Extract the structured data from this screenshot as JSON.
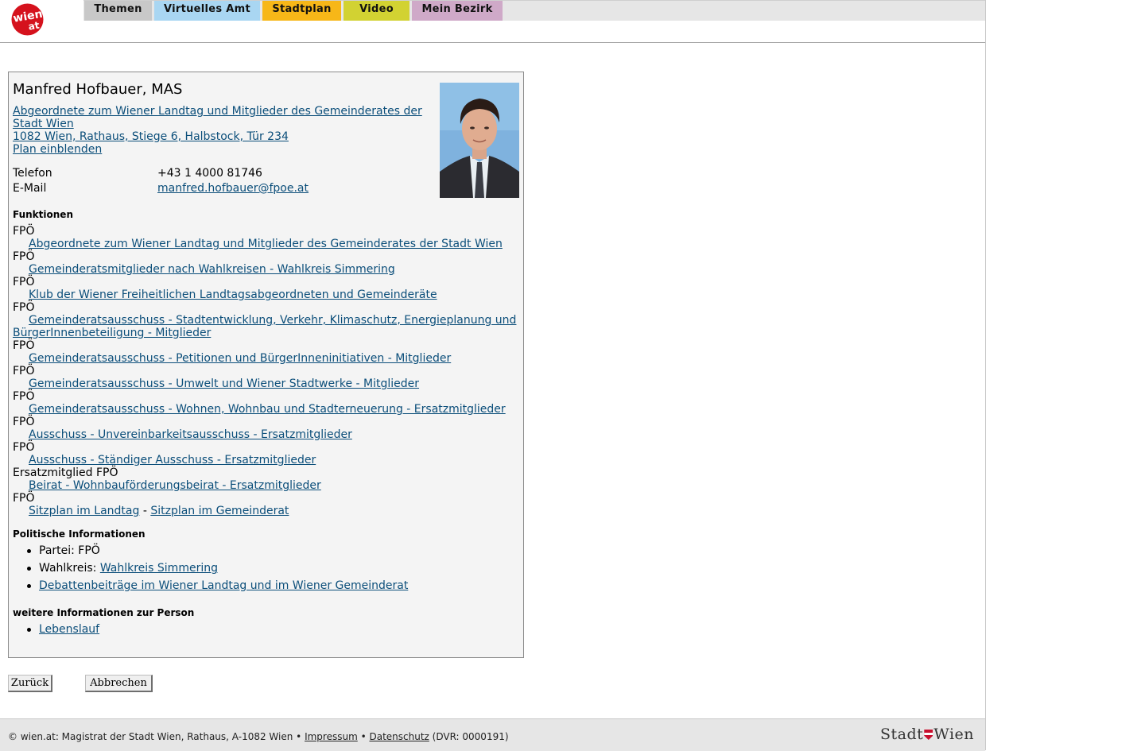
{
  "header": {
    "logo_text": "wien.at",
    "nav": [
      {
        "label": "Themen",
        "color": "#c8c8c8"
      },
      {
        "label": "Virtuelles Amt",
        "color": "#a9d6f2"
      },
      {
        "label": "Stadtplan",
        "color": "#f7b718"
      },
      {
        "label": "Video",
        "color": "#d2d232"
      },
      {
        "label": "Mein Bezirk",
        "color": "#cfa9c8"
      }
    ]
  },
  "person": {
    "name": "Manfred Hofbauer, MAS",
    "org_line1": "Abgeordnete zum Wiener Landtag und Mitglieder des Gemeinderates der",
    "org_line2": "Stadt Wien ",
    "address": "1082 Wien, Rathaus, Stiege 6, Halbstock, Tür 234",
    "plan_link": "Plan einblenden",
    "phone_label": "Telefon",
    "phone": "+43 1 4000 81746",
    "email_label": "E-Mail",
    "email": "manfred.hofbauer@fpoe.at"
  },
  "functions": {
    "heading": "Funktionen",
    "items": [
      {
        "party": "FPÖ",
        "link": "Abgeordnete zum Wiener Landtag und Mitglieder des Gemeinderates der Stadt Wien"
      },
      {
        "party": "FPÖ",
        "link": "Gemeinderatsmitglieder nach Wahlkreisen - Wahlkreis Simmering"
      },
      {
        "party": "FPÖ",
        "link": "Klub der Wiener Freiheitlichen Landtagsabgeordneten und Gemeinderäte"
      },
      {
        "party": "FPÖ",
        "link": "Gemeinderatsausschuss - Stadtentwicklung, Verkehr, Klimaschutz, Energieplanung und",
        "link_cont": "BürgerInnenbeteiligung - Mitglieder"
      },
      {
        "party": "FPÖ",
        "link": "Gemeinderatsausschuss - Petitionen und BürgerInneninitiativen - Mitglieder"
      },
      {
        "party": "FPÖ",
        "link": "Gemeinderatsausschuss - Umwelt und Wiener Stadtwerke - Mitglieder"
      },
      {
        "party": "FPÖ",
        "link": "Gemeinderatsausschuss - Wohnen, Wohnbau und Stadterneuerung - Ersatzmitglieder"
      },
      {
        "party": "FPÖ",
        "link": "Ausschuss - Unvereinbarkeitsausschuss - Ersatzmitglieder"
      },
      {
        "party": "FPÖ",
        "link": "Ausschuss - Ständiger Ausschuss - Ersatzmitglieder"
      },
      {
        "party": "Ersatzmitglied FPÖ",
        "link": "Beirat - Wohnbauförderungsbeirat - Ersatzmitglieder"
      }
    ],
    "seating": {
      "party": "FPÖ",
      "landtag": "Sitzplan im Landtag",
      "separator": " - ",
      "gemeinderat": "Sitzplan im Gemeinderat"
    }
  },
  "political": {
    "heading": "Politische Informationen",
    "party_text": "Partei: FPÖ",
    "district_label": "Wahlkreis: ",
    "district_link": "Wahlkreis Simmering",
    "debates_link": "Debattenbeiträge im Wiener Landtag und im Wiener Gemeinderat"
  },
  "further": {
    "heading": "weitere Informationen zur Person",
    "cv_link": "Lebenslauf"
  },
  "buttons": {
    "back": "Zurück",
    "cancel": "Abbrechen"
  },
  "footer": {
    "prefix": "© wien.at: Magistrat der Stadt Wien, Rathaus, A-1082 Wien • ",
    "impressum": "Impressum",
    "sep": " • ",
    "datenschutz": "Datenschutz",
    "dvr": " (DVR: 0000191)",
    "brand_left": "Stadt",
    "brand_right": "Wien"
  }
}
